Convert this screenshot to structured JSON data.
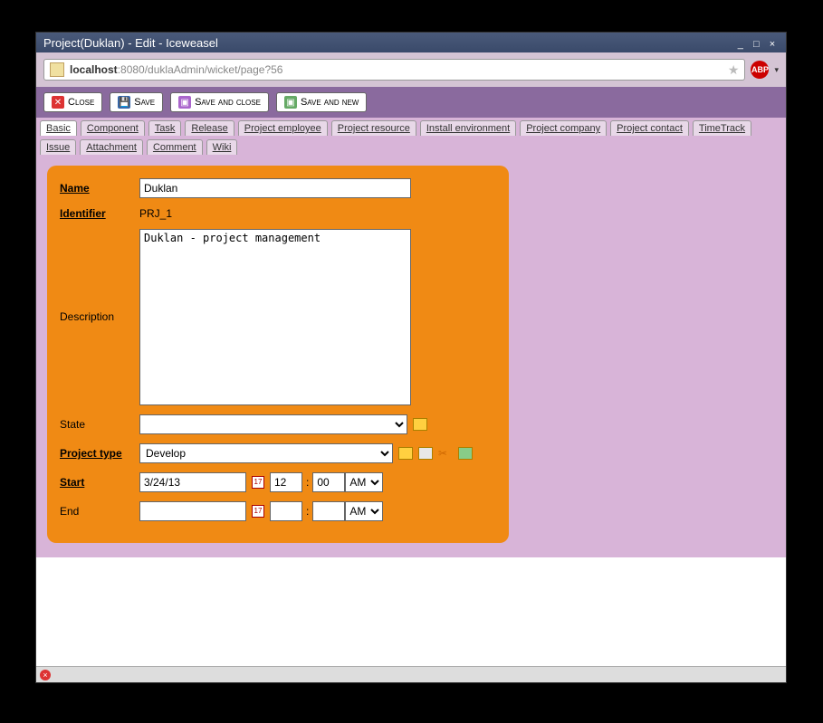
{
  "window": {
    "title": "Project(Duklan) - Edit - Iceweasel"
  },
  "url": {
    "host": "localhost",
    "path": ":8080/duklaAdmin/wicket/page?56"
  },
  "abp": {
    "label": "ABP"
  },
  "toolbar": {
    "close": "Close",
    "save": "Save",
    "save_close": "Save and close",
    "save_new": "Save and new"
  },
  "tabs": [
    "Basic ",
    "Component ",
    "Task ",
    "Release ",
    "Project employee ",
    "Project resource ",
    "Install environment ",
    "Project company ",
    "Project contact ",
    "TimeTrack ",
    "Issue ",
    "Attachment ",
    "Comment ",
    "Wiki "
  ],
  "form": {
    "labels": {
      "name": "Name",
      "identifier": "Identifier",
      "description": "Description",
      "state": "State",
      "project_type": "Project type",
      "start": "Start",
      "end": "End"
    },
    "name": "Duklan",
    "identifier": "PRJ_1",
    "description": "Duklan - project management",
    "state": "",
    "project_type": "Develop",
    "start": {
      "date": "3/24/13",
      "hh": "12",
      "mm": "00",
      "ampm": "AM"
    },
    "end": {
      "date": "",
      "hh": "",
      "mm": "",
      "ampm": "AM"
    },
    "cal_icon_text": "17"
  }
}
